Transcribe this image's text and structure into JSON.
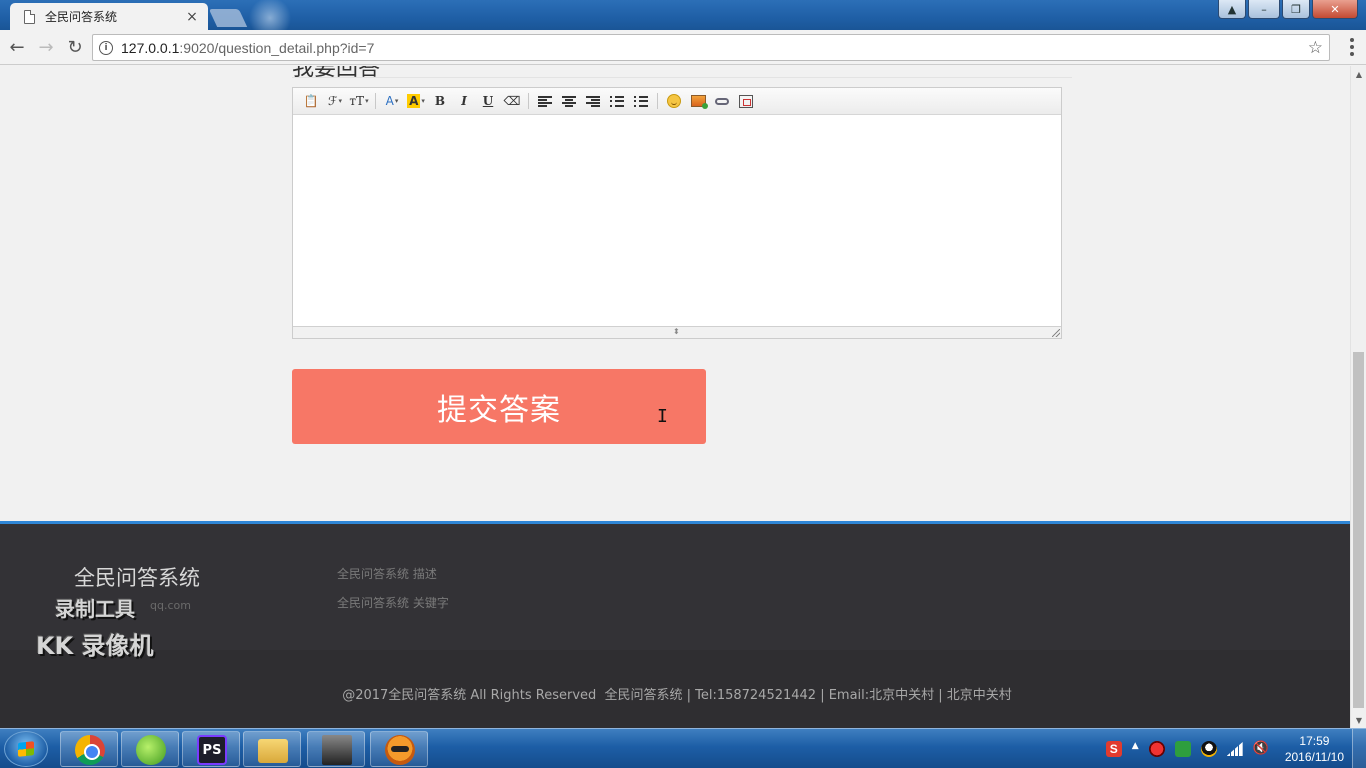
{
  "browser": {
    "tab_title": "全民问答系统",
    "tab_close": "×",
    "url_host": "127.0.0.1",
    "url_rest": ":9020/question_detail.php?id=7",
    "back_glyph": "←",
    "forward_glyph": "→",
    "reload_glyph": "↻",
    "info_glyph": "i",
    "star_glyph": "☆",
    "window_minimize": "–",
    "window_maximize": "❐",
    "window_close": "✕"
  },
  "page": {
    "heading_peek": "我要回答",
    "editor_toolbar": {
      "clipboard": "📋",
      "font_family": "ℱ",
      "font_size": "тT",
      "font_color": "A",
      "highlight": "A",
      "bold": "B",
      "italic": "I",
      "underline": "U",
      "eraser": "⌫",
      "ordered_list": "≡",
      "resize_grip": "⬍"
    },
    "submit_label": "提交答案",
    "text_cursor": "I"
  },
  "footer": {
    "site_name": "全民问答系统",
    "email_partial": "qq.com",
    "description": "全民问答系统 描述",
    "keywords": "全民问答系统 关键字",
    "copyright": "@2017全民问答系统 All Rights Reserved",
    "contact": "全民问答系统 |  Tel:158724521442  | Email:北京中关村 |  北京中关村"
  },
  "watermark": {
    "line1": "录制工具",
    "line2": "KK 录像机"
  },
  "scrollbar": {
    "up": "▲",
    "down": "▼"
  },
  "taskbar": {
    "apps": [
      "chrome-icon",
      "green-app-icon",
      "phpstorm-icon",
      "folder-icon",
      "photo-icon",
      "ninja-app-icon"
    ],
    "ps_label": "PS",
    "tray_sogou": "S",
    "tray_arrow": "▲",
    "tray_volume": "🔇",
    "time": "17:59",
    "date": "2016/11/10"
  }
}
